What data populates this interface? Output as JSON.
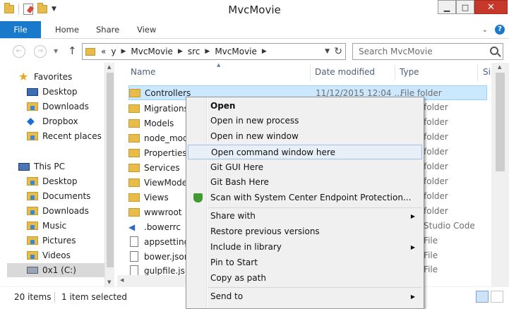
{
  "window": {
    "title": "MvcMovie"
  },
  "ribbon": {
    "tabs": [
      "File",
      "Home",
      "Share",
      "View"
    ]
  },
  "address": {
    "crumbs": [
      "«",
      "y",
      "MvcMovie",
      "src",
      "MvcMovie"
    ],
    "search_placeholder": "Search MvcMovie"
  },
  "navpane": {
    "items": [
      {
        "label": "Favorites",
        "icon": "star-icon"
      },
      {
        "label": "Desktop",
        "icon": "desktop-icon"
      },
      {
        "label": "Downloads",
        "icon": "downloads-folder-icon"
      },
      {
        "label": "Dropbox",
        "icon": "dropbox-icon"
      },
      {
        "label": "Recent places",
        "icon": "recent-places-icon"
      },
      {
        "label": "This PC",
        "icon": "computer-icon"
      },
      {
        "label": "Desktop",
        "icon": "desktop-folder-icon"
      },
      {
        "label": "Documents",
        "icon": "documents-folder-icon"
      },
      {
        "label": "Downloads",
        "icon": "downloads-folder-icon"
      },
      {
        "label": "Music",
        "icon": "music-folder-icon"
      },
      {
        "label": "Pictures",
        "icon": "pictures-folder-icon"
      },
      {
        "label": "Videos",
        "icon": "videos-folder-icon"
      },
      {
        "label": "0x1 (C:)",
        "icon": "drive-icon"
      }
    ]
  },
  "columns": {
    "name": "Name",
    "date": "Date modified",
    "type": "Type",
    "size": "Si"
  },
  "files": [
    {
      "name": "Controllers",
      "date": "11/12/2015 12:04 ...",
      "type": "File folder"
    },
    {
      "name": "Migrations",
      "date": "",
      "type": ""
    },
    {
      "name": "Models",
      "date": "",
      "type": ""
    },
    {
      "name": "node_mod",
      "date": "",
      "type": ""
    },
    {
      "name": "Properties",
      "date": "",
      "type": ""
    },
    {
      "name": "Services",
      "date": "",
      "type": ""
    },
    {
      "name": "ViewMode",
      "date": "",
      "type": ""
    },
    {
      "name": "Views",
      "date": "",
      "type": ""
    },
    {
      "name": "wwwroot",
      "date": "",
      "type": ""
    },
    {
      "name": ".bowerrc",
      "date": "",
      "type": ""
    },
    {
      "name": "appsetting",
      "date": "",
      "type": ""
    },
    {
      "name": "bower.json",
      "date": "",
      "type": ""
    },
    {
      "name": "gulpfile.js",
      "date": "",
      "type": ""
    }
  ],
  "partial_types": [
    "folder",
    "folder",
    "folder",
    "folder",
    "folder",
    "folder",
    "folder",
    "folder",
    "Studio Code",
    "File",
    "File",
    "File"
  ],
  "context_menu": {
    "items": [
      {
        "label": "Open"
      },
      {
        "label": "Open in new process"
      },
      {
        "label": "Open in new window"
      },
      {
        "label": "Open command window here"
      },
      {
        "label": "Git GUI Here"
      },
      {
        "label": "Git Bash Here"
      },
      {
        "label": "Scan with System Center Endpoint Protection..."
      },
      {
        "label": "Share with"
      },
      {
        "label": "Restore previous versions"
      },
      {
        "label": "Include in library"
      },
      {
        "label": "Pin to Start"
      },
      {
        "label": "Copy as path"
      },
      {
        "label": "Send to"
      }
    ]
  },
  "status": {
    "count": "20 items",
    "selected": "1 item selected"
  }
}
